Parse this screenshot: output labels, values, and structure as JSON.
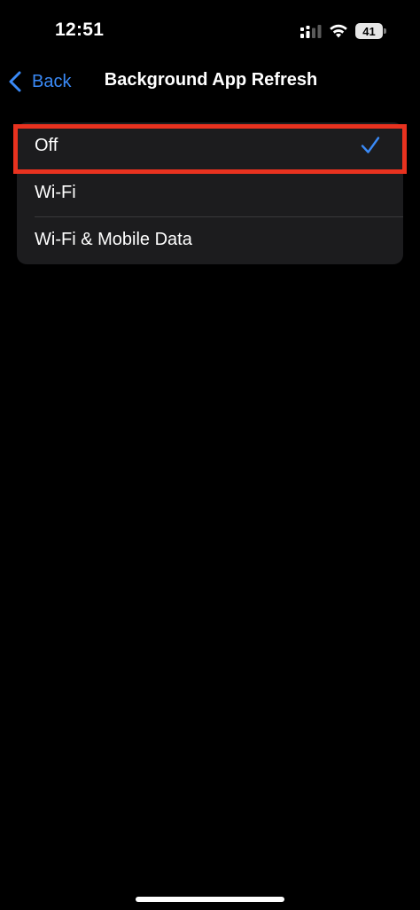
{
  "status_bar": {
    "time": "12:51",
    "battery_level": "41",
    "icons": [
      "signal-icon",
      "wifi-icon",
      "battery-icon"
    ]
  },
  "nav": {
    "back_label": "Back",
    "title": "Background App Refresh"
  },
  "options": [
    {
      "label": "Off",
      "selected": true
    },
    {
      "label": "Wi-Fi",
      "selected": false
    },
    {
      "label": "Wi-Fi & Mobile Data",
      "selected": false
    }
  ],
  "colors": {
    "accent": "#3a8af7",
    "background": "#000000",
    "group_background": "#1c1c1e",
    "highlight": "#e8321f"
  }
}
